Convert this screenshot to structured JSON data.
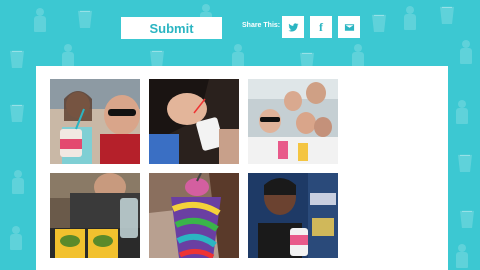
{
  "actions": {
    "submit_label": "Submit",
    "share_label": "Share This:"
  },
  "share": [
    {
      "name": "twitter",
      "icon": "twitter-icon"
    },
    {
      "name": "facebook",
      "icon": "facebook-icon",
      "glyph": "f"
    },
    {
      "name": "email",
      "icon": "email-icon"
    }
  ],
  "gallery": {
    "photos": [
      {
        "description": "man with sunglasses and girl with drink"
      },
      {
        "description": "woman sipping straw"
      },
      {
        "description": "group selfie"
      },
      {
        "description": "person holding snacks"
      },
      {
        "description": "striped frozen drink cup"
      },
      {
        "description": "woman making face with drink"
      }
    ]
  },
  "colors": {
    "background": "#3cc8d2",
    "accent": "#2bb5c2",
    "panel": "#ffffff"
  }
}
